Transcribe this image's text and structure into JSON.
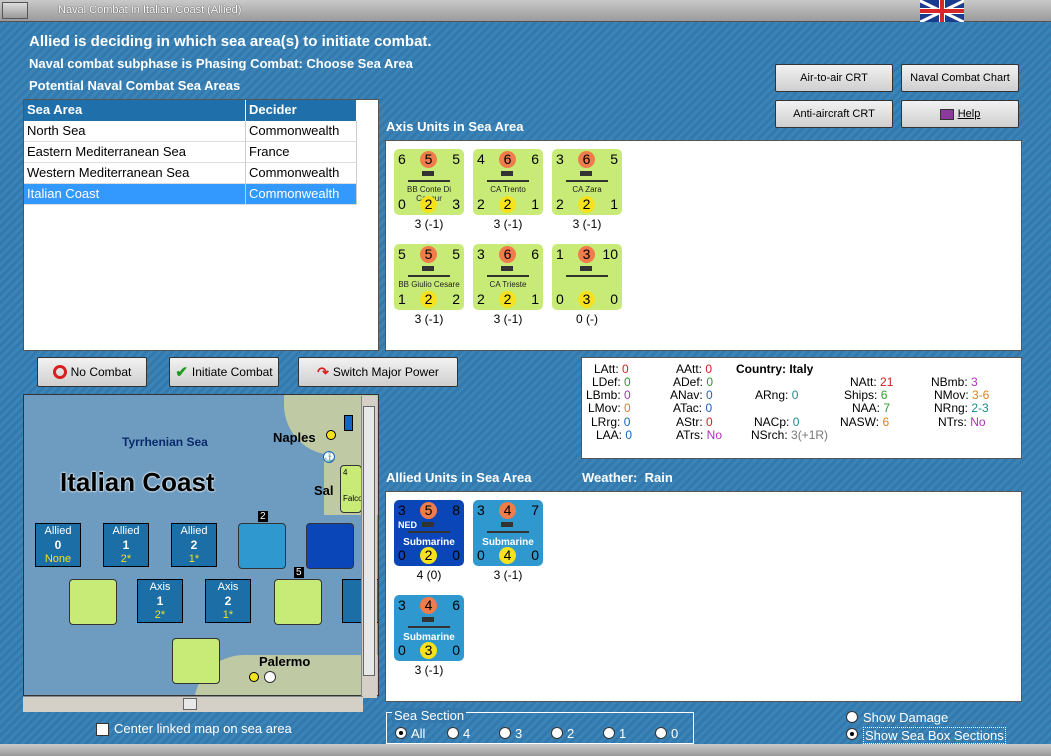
{
  "window": {
    "title": "Naval Combat In Italian Coast (Allied)"
  },
  "header": {
    "line1": "Allied is deciding in which sea area(s) to initiate combat.",
    "line2": "Naval combat subphase is Phasing Combat: Choose Sea Area",
    "line3": "Potential Naval Combat Sea Areas"
  },
  "buttons": {
    "air_crt": "Air-to-air CRT",
    "naval_chart": "Naval Combat Chart",
    "aa_crt": "Anti-aircraft CRT",
    "help": "Help",
    "no_combat": "No Combat",
    "initiate": "Initiate Combat",
    "switch": "Switch Major Power"
  },
  "sea_table": {
    "headers": [
      "Sea Area",
      "Decider"
    ],
    "rows": [
      [
        "North Sea",
        "Commonwealth"
      ],
      [
        "Eastern Mediterranean Sea",
        "France"
      ],
      [
        "Western Mediterranean Sea",
        "Commonwealth"
      ],
      [
        "Italian Coast",
        "Commonwealth"
      ]
    ]
  },
  "axis_units": {
    "title": "Axis Units in Sea Area",
    "units": [
      {
        "tl": "6",
        "tc": "5",
        "tr": "5",
        "name": "BB Conte Di Cavour",
        "bl": "0",
        "bc": "2",
        "br": "3",
        "label": "3 (-1)"
      },
      {
        "tl": "4",
        "tc": "6",
        "tr": "6",
        "name": "CA Trento",
        "bl": "2",
        "bc": "2",
        "br": "1",
        "label": "3 (-1)"
      },
      {
        "tl": "3",
        "tc": "6",
        "tr": "5",
        "name": "CA Zara",
        "bl": "2",
        "bc": "2",
        "br": "1",
        "label": "3 (-1)"
      },
      {
        "tl": "5",
        "tc": "5",
        "tr": "5",
        "name": "BB Giulio Cesare",
        "bl": "1",
        "bc": "2",
        "br": "2",
        "label": "3 (-1)"
      },
      {
        "tl": "3",
        "tc": "6",
        "tr": "6",
        "name": "CA Trieste",
        "bl": "2",
        "bc": "2",
        "br": "1",
        "label": "3 (-1)"
      },
      {
        "tl": "1",
        "tc": "3",
        "tr": "10",
        "name": "",
        "bl": "0",
        "bc": "3",
        "br": "0",
        "label": "0 (-)"
      }
    ]
  },
  "stats": {
    "country_label": "Country:",
    "country": "Italy",
    "LAtt": "0",
    "LDef": "0",
    "LBmb": "0",
    "LMov": "0",
    "LRrg": "0",
    "LAA": "0",
    "AAtt": "0",
    "ADef": "0",
    "ANav": "0",
    "ATac": "0",
    "AStr": "0",
    "ATrs": "No",
    "ARng": "0",
    "NACp": "0",
    "NSrch": "3(+1R)",
    "NAtt": "21",
    "Ships": "6",
    "NAA": "7",
    "NASW": "6",
    "NBmb": "3",
    "NMov": "3-6",
    "NRng": "2-3",
    "NTrs": "No"
  },
  "allied_units": {
    "title": "Allied Units in Sea Area",
    "weather_label": "Weather:",
    "weather": "Rain",
    "units": [
      {
        "tl": "3",
        "tc": "5",
        "tr": "8",
        "tag": "NED",
        "name": "Submarine",
        "bl": "0",
        "bc": "2",
        "br": "0",
        "label": "4 (0)"
      },
      {
        "tl": "3",
        "tc": "4",
        "tr": "7",
        "tag": "",
        "name": "Submarine",
        "bl": "0",
        "bc": "4",
        "br": "0",
        "label": "3 (-1)"
      },
      {
        "tl": "3",
        "tc": "4",
        "tr": "6",
        "tag": "",
        "name": "Submarine",
        "bl": "0",
        "bc": "3",
        "br": "0",
        "label": "3 (-1)"
      }
    ]
  },
  "map": {
    "title": "Italian Coast",
    "sea_label": "Tyrrhenian Sea",
    "city1": "Naples",
    "city2": "Sal",
    "city3": "Palermo",
    "allied_boxes": [
      {
        "name": "Allied",
        "val": "0",
        "note": "None"
      },
      {
        "name": "Allied",
        "val": "1",
        "note": "2*"
      },
      {
        "name": "Allied",
        "val": "2",
        "note": "1*"
      }
    ],
    "axis_boxes": [
      {
        "name": "Axis",
        "val": "1",
        "note": "2*"
      },
      {
        "name": "Axis",
        "val": "2",
        "note": "1*"
      },
      {
        "name": "A",
        "val": "",
        "note": ""
      }
    ],
    "counter_labels": [
      "2",
      "5"
    ],
    "falco": "Falco"
  },
  "controls": {
    "center_linked": "Center linked map on sea area",
    "sea_section": "Sea Section",
    "sections": [
      "All",
      "4",
      "3",
      "2",
      "1",
      "0"
    ],
    "show_damage": "Show Damage",
    "show_sections": "Show Sea Box Sections"
  }
}
